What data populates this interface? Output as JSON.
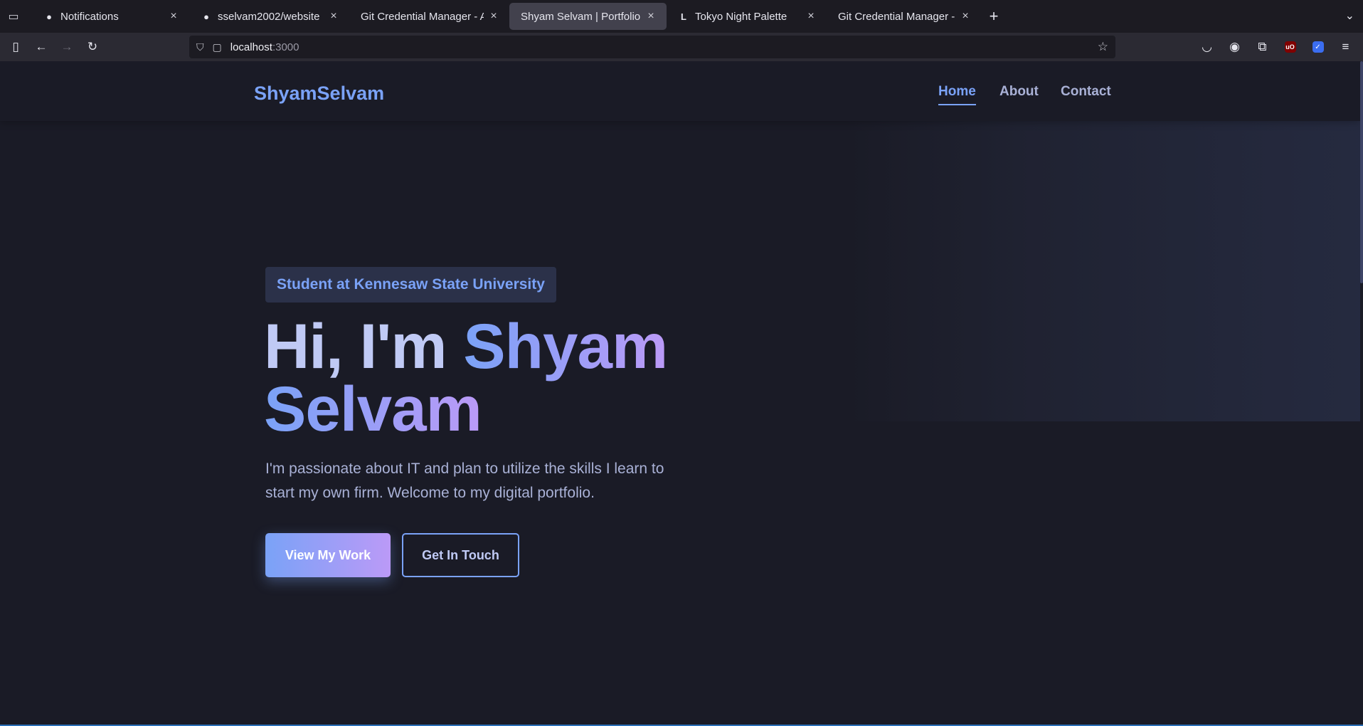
{
  "browser": {
    "tabs": [
      {
        "title": "Notifications",
        "icon": "github-icon",
        "active": false
      },
      {
        "title": "sselvam2002/website",
        "icon": "github-icon",
        "active": false
      },
      {
        "title": "Git Credential Manager - Auth",
        "icon": "",
        "active": false
      },
      {
        "title": "Shyam Selvam | Portfolio",
        "icon": "",
        "active": true
      },
      {
        "title": "Tokyo Night Palette",
        "icon": "lospec-icon",
        "active": false
      },
      {
        "title": "Git Credential Manager - Auth",
        "icon": "",
        "active": false
      }
    ],
    "url_host": "localhost",
    "url_port": ":3000"
  },
  "site": {
    "brand": "ShyamSelvam",
    "nav": [
      {
        "label": "Home",
        "active": true
      },
      {
        "label": "About",
        "active": false
      },
      {
        "label": "Contact",
        "active": false
      }
    ],
    "badge": "Student at Kennesaw State University",
    "title_greeting": "Hi, I'm ",
    "title_name_line1": "Shyam",
    "title_name_line2": "Selvam",
    "description": "I'm passionate about IT and plan to utilize the skills I learn to start my own firm. Welcome to my digital portfolio.",
    "primary_button": "View My Work",
    "secondary_button": "Get In Touch"
  },
  "colors": {
    "background": "#1a1b26",
    "accent_blue": "#7aa2f7",
    "accent_purple": "#bb9af7",
    "text": "#a9b1d6"
  }
}
